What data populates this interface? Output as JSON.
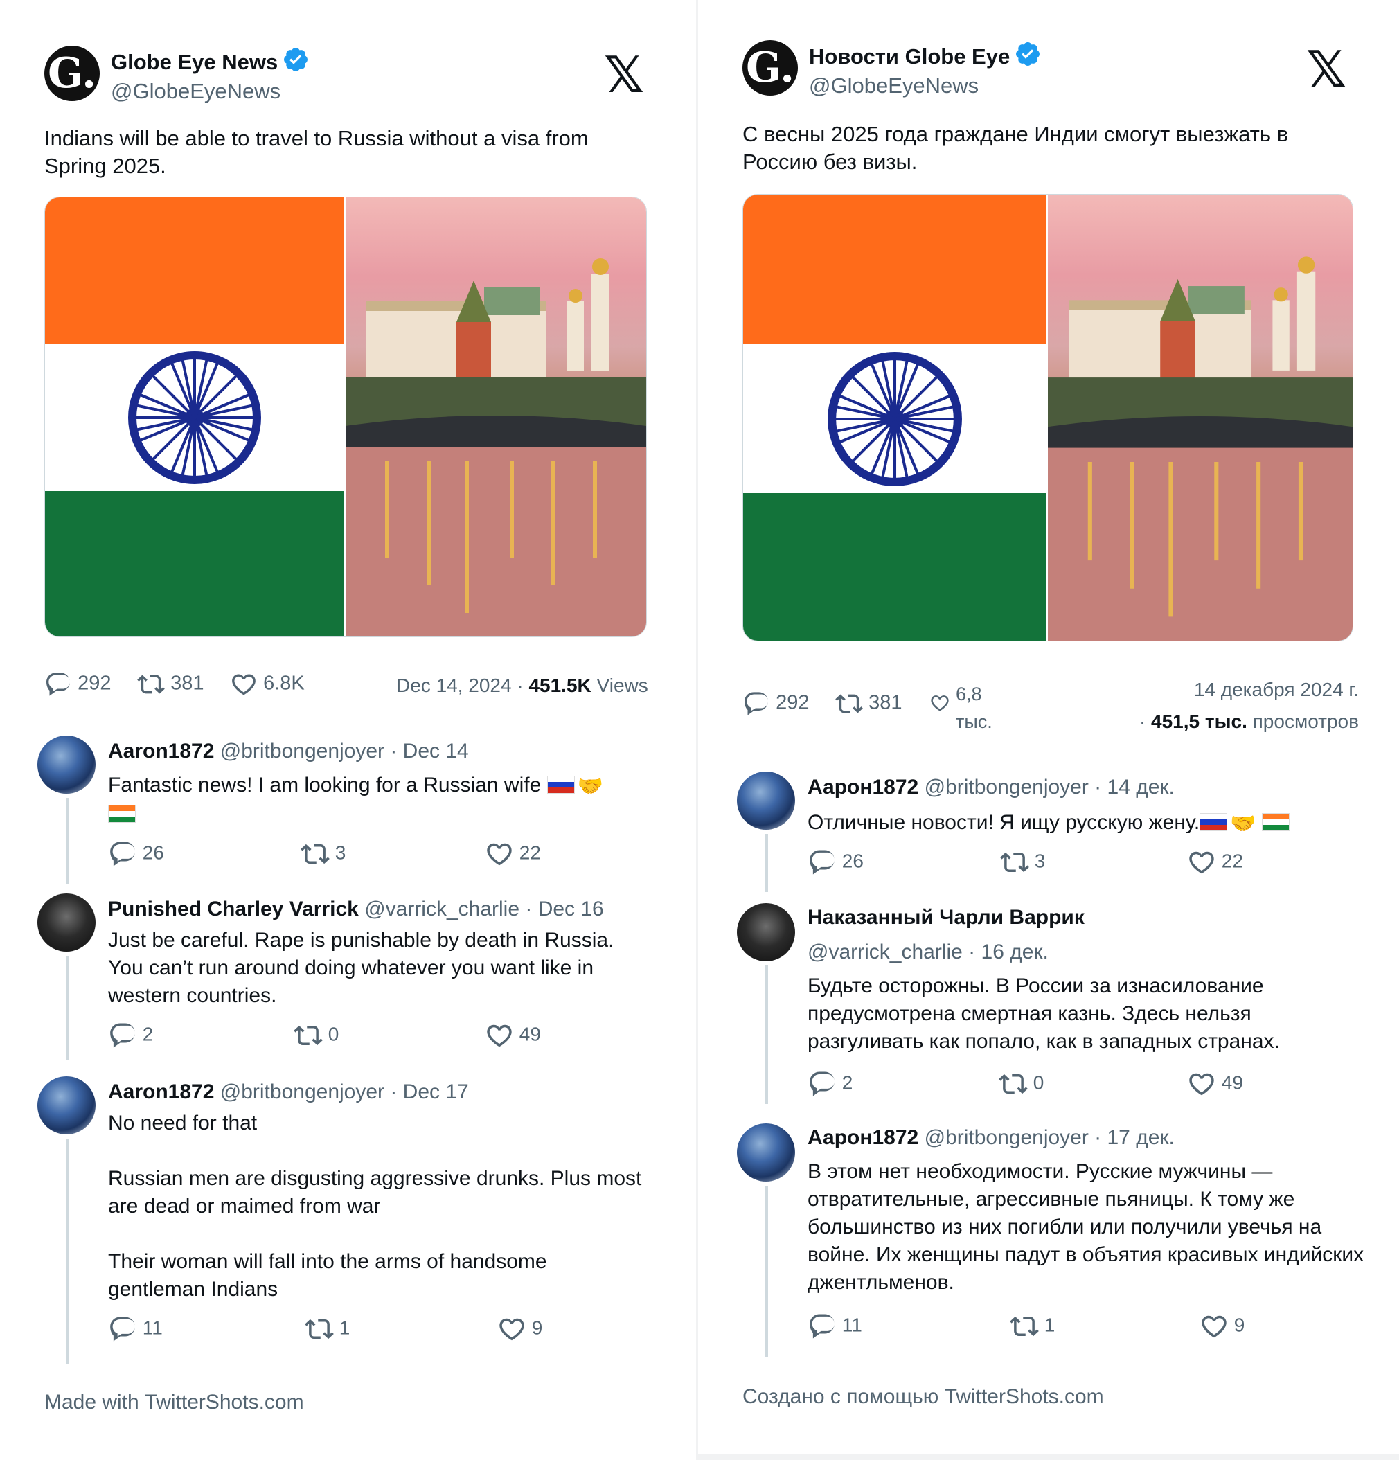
{
  "colors": {
    "verified": "#1d9bf0",
    "text": "#0f1419",
    "secondary": "#536471",
    "saffron": "#ff6b1a",
    "india_green": "#13733a",
    "chakra_blue": "#1a2a8f"
  },
  "en": {
    "author": {
      "name": "Globe Eye News",
      "handle": "@GlobeEyeNews",
      "logo_letter": "G."
    },
    "x_logo": "𝕏",
    "text": "Indians will be able to travel to Russia without a visa from Spring 2025.",
    "stats": {
      "replies": "292",
      "retweets": "381",
      "likes": "6.8K"
    },
    "meta": {
      "date": "Dec 14, 2024",
      "sep": " · ",
      "views_count": "451.5K",
      "views_label": "Views"
    },
    "replies": [
      {
        "name": "Aaron1872",
        "sub": "@britbongenjoyer · Dec 14",
        "text": "Fantastic news! I am looking for a Russian wife",
        "replies": "26",
        "retweets": "3",
        "likes": "22"
      },
      {
        "name": "Punished Charley Varrick",
        "sub": "@varrick_charlie · Dec 16",
        "text": "Just be careful. Rape is punishable by death in Russia. You can’t run around doing whatever you want like in western countries.",
        "replies": "2",
        "retweets": "0",
        "likes": "49"
      },
      {
        "name": "Aaron1872",
        "sub": "@britbongenjoyer · Dec 17",
        "text": "No need for that\n\nRussian men are disgusting aggressive drunks. Plus most are dead or maimed from war\n\nTheir woman will fall into the arms of handsome gentleman Indians",
        "replies": "11",
        "retweets": "1",
        "likes": "9"
      }
    ],
    "footer": "Made with TwitterShots.com"
  },
  "ru": {
    "author": {
      "name": "Новости Globe Eye",
      "handle": "@GlobeEyeNews",
      "logo_letter": "G."
    },
    "x_logo": "𝕏",
    "text": "С весны 2025 года граждане Индии смогут выезжать в Россию без визы.",
    "stats": {
      "replies": "292",
      "retweets": "381",
      "likes_line1": "6,8",
      "likes_line2": "тыс."
    },
    "meta": {
      "date": "14 декабря 2024 г.",
      "sep": "· ",
      "views_count": "451,5 тыс.",
      "views_label": "просмотров"
    },
    "replies": [
      {
        "name": "Аарон1872",
        "sub": "@britbongenjoyer · 14 дек.",
        "text": "Отличные новости! Я ищу русскую жену.",
        "replies": "26",
        "retweets": "3",
        "likes": "22"
      },
      {
        "name": "Наказанный Чарли Варрик",
        "sub": "@varrick_charlie · 16 дек.",
        "text": "Будьте осторожны. В России за изнасилование предусмотрена смертная казнь. Здесь нельзя разгуливать как попало, как в западных странах.",
        "replies": "2",
        "retweets": "0",
        "likes": "49"
      },
      {
        "name": "Аарон1872",
        "sub": "@britbongenjoyer · 17 дек.",
        "text": "В этом нет необходимости. Русские мужчины — отвратительные, агрессивные пьяницы. К тому же большинство из них погибли или получили увечья на войне. Их женщины падут в объятия красивых индийских джентльменов.",
        "replies": "11",
        "retweets": "1",
        "likes": "9"
      }
    ],
    "footer": "Создано с помощью TwitterShots.com"
  }
}
